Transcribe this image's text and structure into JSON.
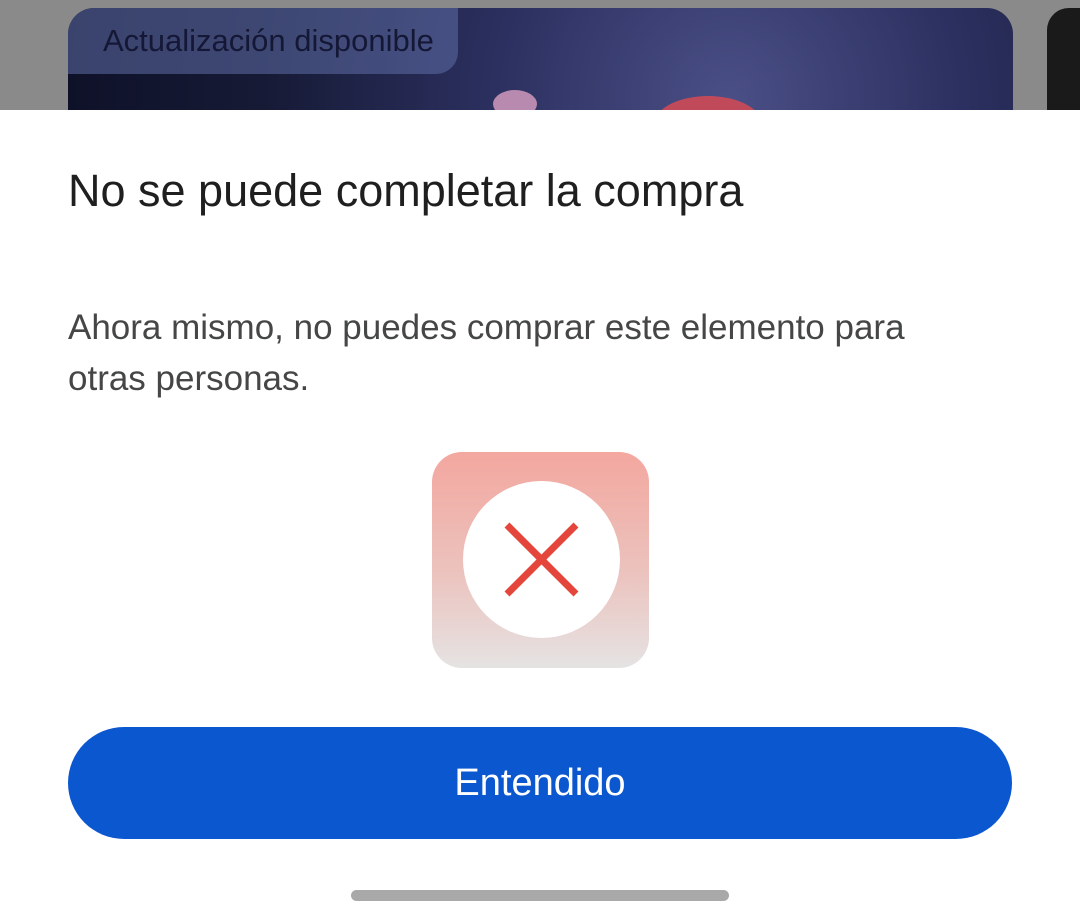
{
  "background_app": {
    "promo_chip_label": "Actualización disponible"
  },
  "dialog": {
    "title": "No se puede completar la compra",
    "message": "Ahora mismo, no puedes comprar este elemento para otras personas.",
    "icon": "error-x-icon",
    "primary_button_label": "Entendido"
  },
  "colors": {
    "primary": "#0b57d0",
    "error": "#e5463b",
    "title_text": "#1f1f1f",
    "body_text": "#444746"
  }
}
